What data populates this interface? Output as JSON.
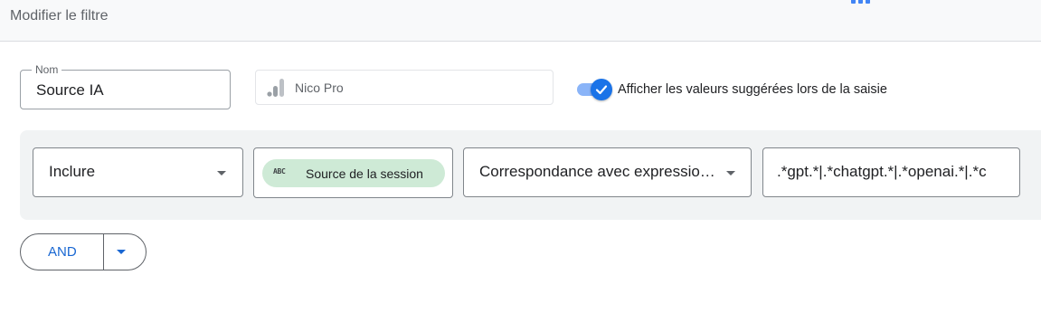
{
  "header": {
    "title": "Modifier le filtre"
  },
  "name_field": {
    "label": "Nom",
    "value": "Source IA"
  },
  "property": {
    "icon": "analytics-icon",
    "name": "Nico Pro"
  },
  "suggestions_toggle": {
    "checked": true,
    "label": "Afficher les valeurs suggérées lors de la saisie"
  },
  "condition": {
    "include_select": "Inclure",
    "dimension_chip": {
      "icon_text": "ABC",
      "label": "Source de la session"
    },
    "match_type": "Correspondance avec expressio…",
    "value": ".*gpt.*|.*chatgpt.*|.*openai.*|.*c"
  },
  "and_button": {
    "label": "AND"
  },
  "colors": {
    "accent": "#1a73e8",
    "toggle_track": "#8ab4f8",
    "chip_bg": "#ceead6",
    "panel_bg": "#f1f3f4",
    "and_text": "#1967d2"
  }
}
